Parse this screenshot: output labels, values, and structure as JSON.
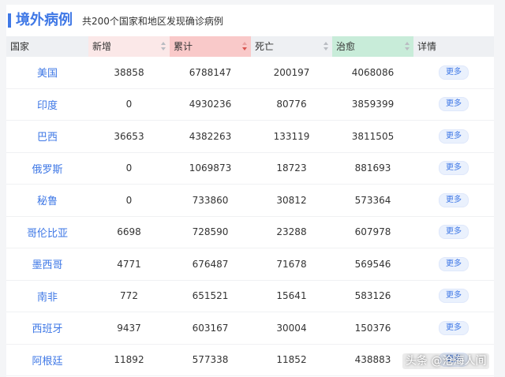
{
  "header": {
    "title": "境外病例",
    "subtitle": "共200个国家和地区发现确诊病例"
  },
  "table": {
    "columns": {
      "country": "国家",
      "new": "新增",
      "total": "累计",
      "dead": "死亡",
      "cured": "治愈",
      "detail": "详情"
    },
    "more_label": "更多",
    "rows": [
      {
        "country": "美国",
        "new": "38858",
        "total": "6788147",
        "dead": "200197",
        "cured": "4068086"
      },
      {
        "country": "印度",
        "new": "0",
        "total": "4930236",
        "dead": "80776",
        "cured": "3859399"
      },
      {
        "country": "巴西",
        "new": "36653",
        "total": "4382263",
        "dead": "133119",
        "cured": "3811505"
      },
      {
        "country": "俄罗斯",
        "new": "0",
        "total": "1069873",
        "dead": "18723",
        "cured": "881693"
      },
      {
        "country": "秘鲁",
        "new": "0",
        "total": "733860",
        "dead": "30812",
        "cured": "573364"
      },
      {
        "country": "哥伦比亚",
        "new": "6698",
        "total": "728590",
        "dead": "23288",
        "cured": "607978"
      },
      {
        "country": "墨西哥",
        "new": "4771",
        "total": "676487",
        "dead": "71678",
        "cured": "569546"
      },
      {
        "country": "南非",
        "new": "772",
        "total": "651521",
        "dead": "15641",
        "cured": "583126"
      },
      {
        "country": "西班牙",
        "new": "9437",
        "total": "603167",
        "dead": "30004",
        "cured": "150376"
      },
      {
        "country": "阿根廷",
        "new": "11892",
        "total": "577338",
        "dead": "11852",
        "cured": "438883"
      }
    ]
  },
  "watermark": "头条 @沧海人间",
  "colors": {
    "accent": "#3f78e6",
    "new_header": "#fbe8e8",
    "total_header": "#f9c9c9",
    "cured_header": "#c8ecd9"
  }
}
